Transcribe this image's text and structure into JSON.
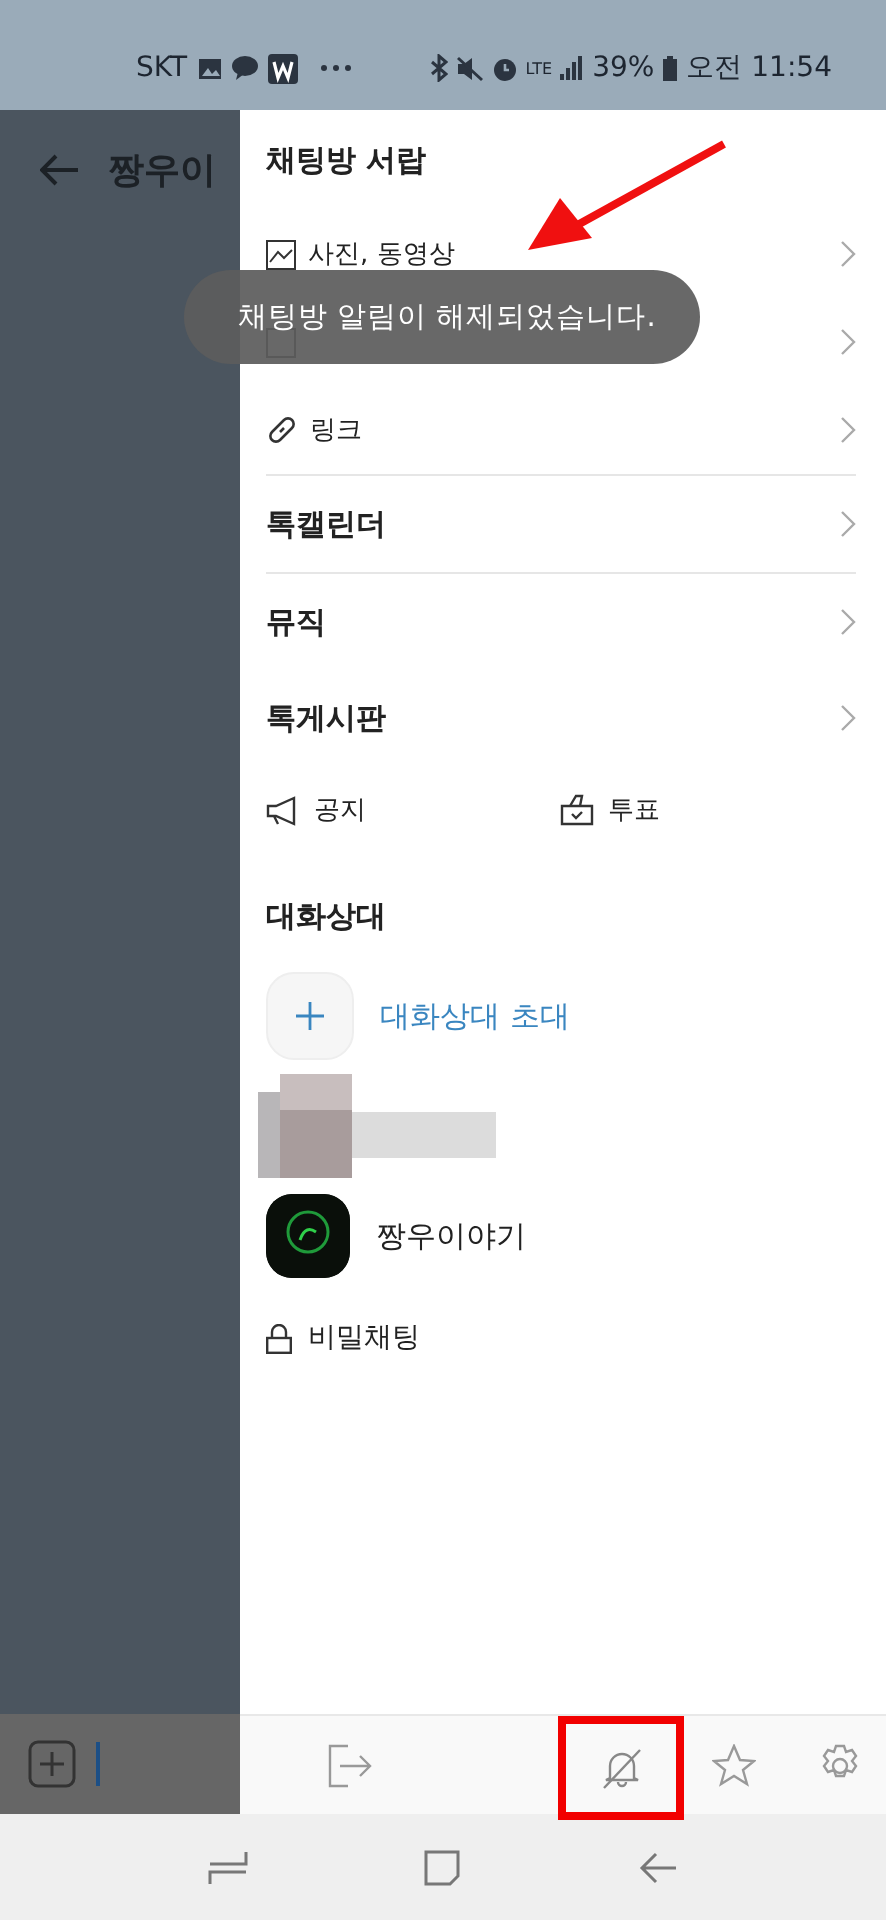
{
  "status_bar": {
    "carrier": "SKT",
    "network": "LTE",
    "battery": "39%",
    "time": "오전 11:54"
  },
  "chat": {
    "title": "짱우이"
  },
  "drawer": {
    "title": "채팅방 서랍",
    "media_items": [
      {
        "kind": "photo",
        "label": "사진, 동영상"
      },
      {
        "kind": "file"
      },
      {
        "kind": "link",
        "label": "링크"
      }
    ],
    "sections": [
      {
        "label": "톡캘린더"
      },
      {
        "label": "뮤직"
      },
      {
        "label": "톡게시판"
      }
    ],
    "shortcuts": [
      {
        "kind": "notice",
        "label": "공지"
      },
      {
        "kind": "poll",
        "label": "투표"
      }
    ],
    "members_title": "대화상대",
    "invite": "대화상대 초대",
    "members": [
      {
        "kind": "redacted"
      },
      {
        "kind": "avatar",
        "name": "짱우이야기"
      }
    ],
    "secret_chat": "비밀채팅"
  },
  "toolbar": {
    "muted": true,
    "highlighted": true
  },
  "toast": "채팅방 알림이 해제되었습니다.",
  "annotation_arrow": true
}
